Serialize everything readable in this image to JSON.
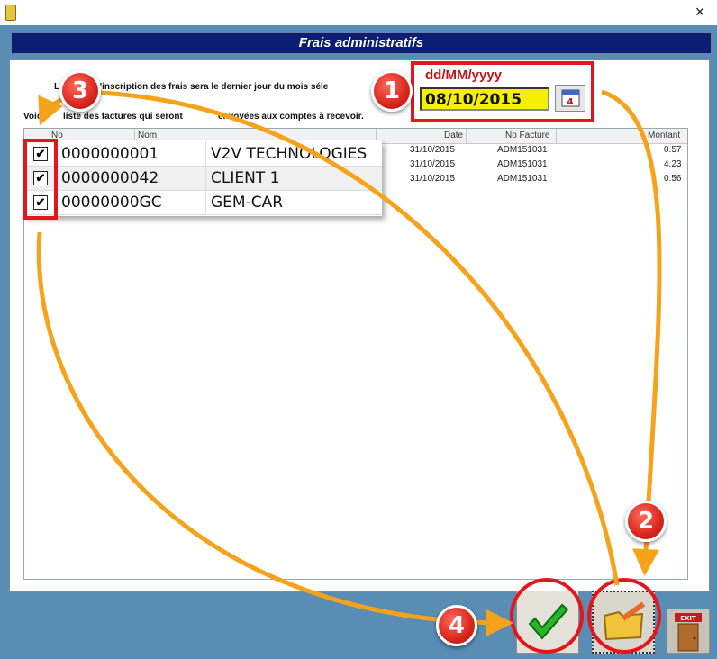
{
  "window": {
    "close_glyph": "×",
    "app_icon": "traffic-light-icon"
  },
  "header": {
    "title": "Frais administratifs"
  },
  "info": {
    "line1_a": "L",
    "line1_b": "l'inscription des frais sera le dernier jour du mois séle",
    "line2_a": "Voic",
    "line2_b": "liste des factures qui seront",
    "line2_c": "envoyées aux comptes à recevoir."
  },
  "date": {
    "format": "dd/MM/yyyy",
    "value": "08/10/2015",
    "calendar_icon": "calendar-icon"
  },
  "grid": {
    "columns": [
      "No",
      "Nom",
      "Date",
      "No Facture",
      "Montant"
    ],
    "rows": [
      {
        "date": "31/10/2015",
        "facture": "ADM151031",
        "montant": "0.57"
      },
      {
        "date": "31/10/2015",
        "facture": "ADM151031",
        "montant": "4.23"
      },
      {
        "date": "31/10/2015",
        "facture": "ADM151031",
        "montant": "0.56"
      }
    ]
  },
  "popup_rows": [
    {
      "checked": "✔",
      "no": "0000000001",
      "nom": "V2V TECHNOLOGIES"
    },
    {
      "checked": "✔",
      "no": "0000000042",
      "nom": "CLIENT 1"
    },
    {
      "checked": "✔",
      "no": "00000000GC",
      "nom": "GEM-CAR"
    }
  ],
  "badges": [
    "1",
    "2",
    "3",
    "4"
  ],
  "buttons": {
    "confirm_icon": "green-check-icon",
    "edit_icon": "folder-pencil-icon",
    "exit_label": "EXIT",
    "exit_icon": "exit-door-icon"
  },
  "colors": {
    "header_bg": "#0b1d74",
    "frame_bg": "#5a8db3",
    "highlight": "#e3161e",
    "arrow": "#f6a21a",
    "date_bg": "#f5f000"
  }
}
